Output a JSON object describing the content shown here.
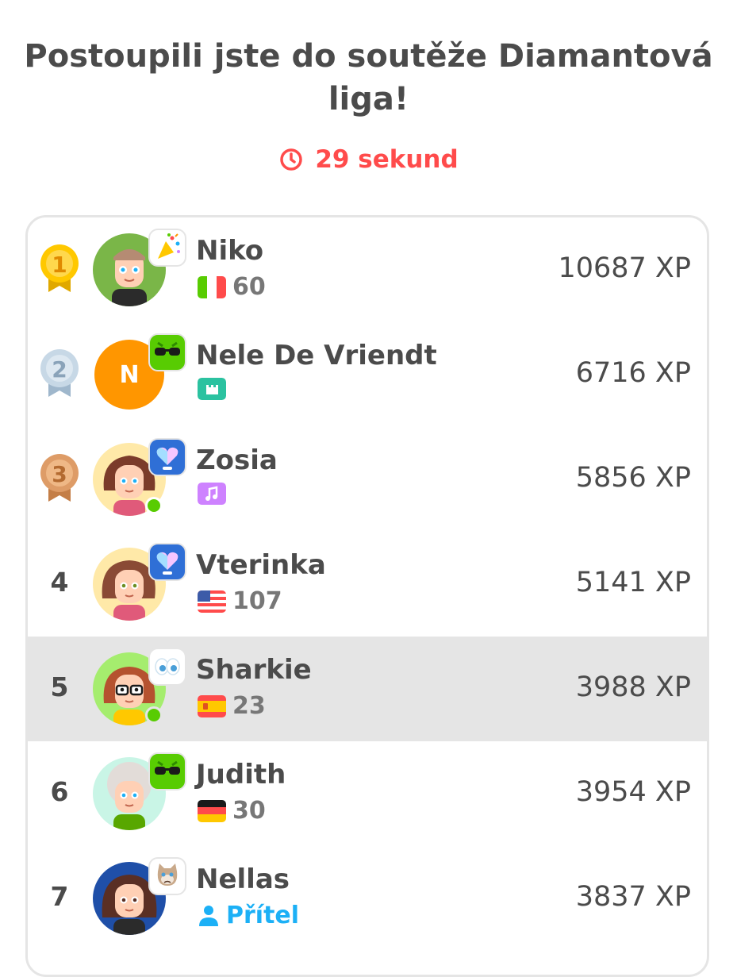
{
  "header": {
    "title_line1": "Postoupili jste do soutěže Diamantová",
    "title_line2": "liga!",
    "timer_text": "29 sekund",
    "timer_icon": "clock-icon"
  },
  "colors": {
    "accent_red": "#ff4b4b",
    "highlight_row": "#e5e5e5",
    "friend_blue": "#1cb0f6"
  },
  "leaderboard": [
    {
      "rank": "1",
      "medal": "gold",
      "name": "Niko",
      "badge": "party-popper-icon",
      "sub_type": "flag",
      "flag": "italy",
      "streak": "60",
      "xp": "10687 XP",
      "online": false
    },
    {
      "rank": "2",
      "medal": "silver",
      "name": "Nele De Vriendt",
      "avatar_letter": "N",
      "badge": "sunglasses-icon",
      "sub_type": "icon",
      "sub_icon": "castle-icon",
      "xp": "6716 XP",
      "online": false
    },
    {
      "rank": "3",
      "medal": "bronze",
      "name": "Zosia",
      "badge": "heart-trophy-icon",
      "sub_type": "icon",
      "sub_icon": "music-note-icon",
      "xp": "5856 XP",
      "online": true
    },
    {
      "rank": "4",
      "name": "Vterinka",
      "badge": "heart-trophy-icon",
      "sub_type": "flag",
      "flag": "usa",
      "streak": "107",
      "xp": "5141 XP",
      "online": false
    },
    {
      "rank": "5",
      "name": "Sharkie",
      "badge": "eyes-icon",
      "sub_type": "flag",
      "flag": "spain",
      "streak": "23",
      "xp": "3988 XP",
      "online": true,
      "current_user": true
    },
    {
      "rank": "6",
      "name": "Judith",
      "badge": "sunglasses-icon",
      "sub_type": "flag",
      "flag": "germany",
      "streak": "30",
      "xp": "3954 XP",
      "online": false
    },
    {
      "rank": "7",
      "name": "Nellas",
      "badge": "grumpy-cat-icon",
      "sub_type": "friend",
      "friend_label": "Přítel",
      "friend_icon": "person-icon",
      "xp": "3837 XP",
      "online": false
    }
  ]
}
